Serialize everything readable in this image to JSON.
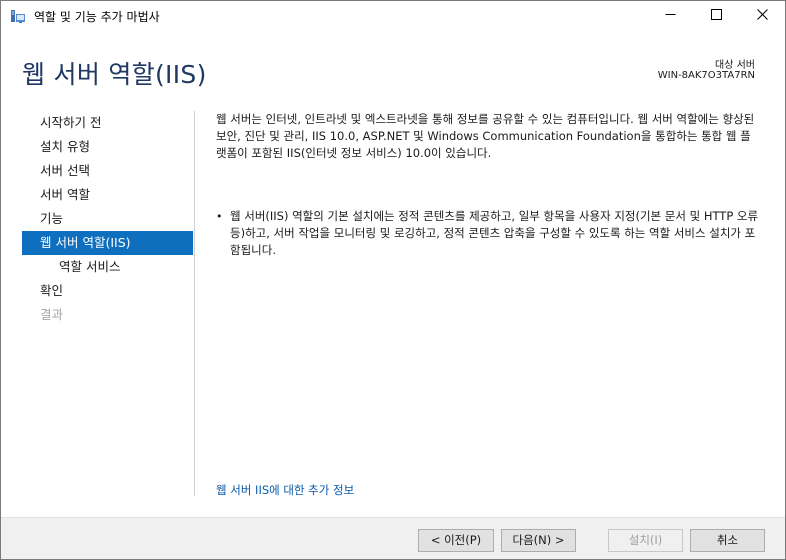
{
  "window": {
    "title": "역할 및 기능 추가 마법사",
    "app_icon": "server-manager-icon",
    "controls": {
      "minimize": "minimize-icon",
      "maximize": "maximize-icon",
      "close": "close-icon"
    }
  },
  "header": {
    "title": "웹 서버 역할(IIS)",
    "target_label": "대상 서버",
    "target_name": "WIN-8AK7O3TA7RN"
  },
  "nav": {
    "items": [
      {
        "label": "시작하기 전",
        "state": "normal"
      },
      {
        "label": "설치 유형",
        "state": "normal"
      },
      {
        "label": "서버 선택",
        "state": "normal"
      },
      {
        "label": "서버 역할",
        "state": "normal"
      },
      {
        "label": "기능",
        "state": "normal"
      },
      {
        "label": "웹 서버 역할(IIS)",
        "state": "active"
      },
      {
        "label": "역할 서비스",
        "state": "sub"
      },
      {
        "label": "확인",
        "state": "normal"
      },
      {
        "label": "결과",
        "state": "disabled"
      }
    ]
  },
  "content": {
    "description": "웹 서버는 인터넷, 인트라넷 및 엑스트라넷을 통해 정보를 공유할 수 있는 컴퓨터입니다. 웹 서버 역할에는 향상된 보안, 진단 및 관리, IIS 10.0, ASP.NET 및 Windows Communication Foundation을 통합하는 통합 웹 플랫폼이 포함된 IIS(인터넷 정보 서비스) 10.0이 있습니다.",
    "bullets": [
      "웹 서버(IIS) 역할의 기본 설치에는 정적 콘텐츠를 제공하고, 일부 항목을 사용자 지정(기본 문서 및 HTTP 오류 등)하고, 서버 작업을 모니터링 및 로깅하고, 정적 콘텐츠 압축을 구성할 수 있도록 하는 역할 서비스 설치가 포함됩니다."
    ],
    "more_info_link": "웹 서버 IIS에 대한 추가 정보"
  },
  "footer": {
    "prev_label": "< 이전(P)",
    "next_label": "다음(N) >",
    "install_label": "설치(I)",
    "cancel_label": "취소"
  },
  "colors": {
    "title_blue": "#1f3864",
    "nav_active_bg": "#0e6fbf",
    "link": "#0b5aa8",
    "disabled_text": "#a5a5a5"
  }
}
